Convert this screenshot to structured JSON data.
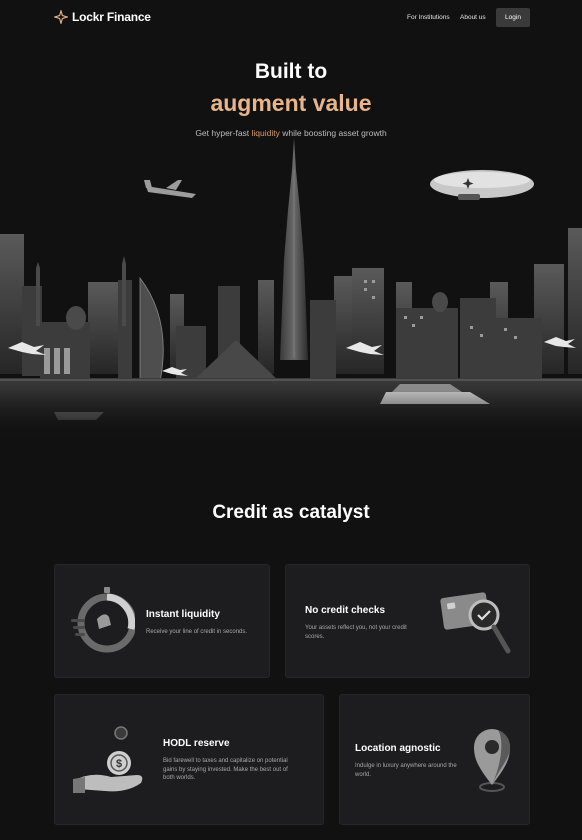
{
  "brand": {
    "name_part1": "Lockr",
    "name_part2": " Finance",
    "accent": "#e8b48a"
  },
  "nav": {
    "links": [
      "For Institutions",
      "About us"
    ],
    "login_label": "Login"
  },
  "hero": {
    "title_line1": "Built to",
    "title_line2": "augment value",
    "subtitle_pre": "Get hyper-fast ",
    "subtitle_highlight": "liquidity",
    "subtitle_post": " while boosting asset growth"
  },
  "features": {
    "section_title": "Credit as catalyst",
    "cards": [
      {
        "title": "Instant liquidity",
        "desc": "Receive your line of credit in seconds.",
        "icon": "stopwatch-icon"
      },
      {
        "title": "No credit checks",
        "desc": "Your assets reflect you, not your credit scores.",
        "icon": "credit-card-magnifier-icon"
      },
      {
        "title": "HODL reserve",
        "desc": "Bid farewell to taxes and capitalize on potential gains by staying invested. Make the best out of both worlds.",
        "icon": "hand-coin-icon"
      },
      {
        "title": "Location agnostic",
        "desc": "Indulge in luxury anywhere around the world.",
        "icon": "map-pin-icon"
      }
    ]
  }
}
